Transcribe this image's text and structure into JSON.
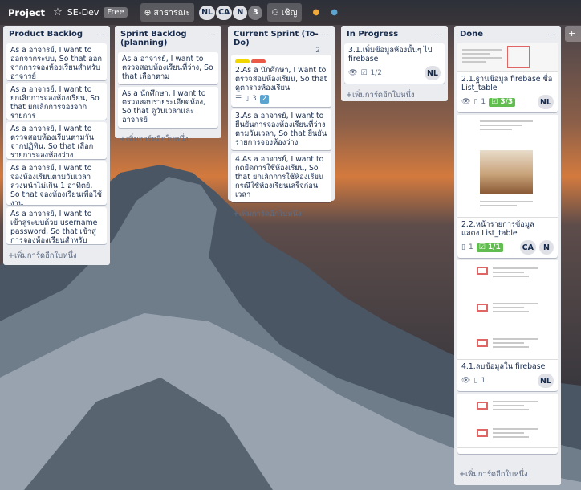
{
  "header": {
    "project": "Project",
    "board_name": "SE-Dev",
    "plan": "Free",
    "visibility": "สาธารณะ",
    "members": [
      "NL",
      "CA",
      "N"
    ],
    "member_count": "3",
    "invite": "เชิญ"
  },
  "lists": [
    {
      "title": "Product Backlog",
      "menu": "...",
      "cards": [
        {
          "text": "As a อาจารย์, I want to ออกจากระบบ, So that ออกจากการจองห้องเรียนสำหรับอาจารย์"
        },
        {
          "text": "As a อาจารย์, I want to ยกเลิกการจองห้องเรียน, So that ยกเลิกการจองจากรายการ"
        },
        {
          "text": "As a อาจารย์, I want to ตรวจสอบห้องเรียนตามวันจากปฏิทิน, So that เลือกรายการจองห้องว่าง"
        },
        {
          "text": "As a อาจารย์, I want to จองห้องเรียนตามวันเวลาล่วงหน้าไม่เกิน 1 อาทิตย์, So that จองห้องเรียนเพื่อใช้งาน"
        },
        {
          "text": "As a อาจารย์, I want to เข้าสู่ระบบด้วย username password, So that เข้าสู่การจองห้องเรียนสำหรับอาจารย์"
        }
      ],
      "add": "+เพิ่มการ์ดอีกใบหนึ่ง"
    },
    {
      "title": "Sprint Backlog (planning)",
      "menu": "...",
      "cards": [
        {
          "text": "As a อาจารย์, I want to ตรวจสอบห้องเรียนที่ว่าง, So that เลือกตาม"
        },
        {
          "text": "As a นักศึกษา, I want to ตรวจสอบรายระเอียดห้อง, So that ดูวันเวลาและอาจารย์"
        }
      ],
      "add": "+เพิ่มการ์ดอีกใบหนึ่ง"
    },
    {
      "title": "Current Sprint (To-Do)",
      "count": "2",
      "menu": "...",
      "cards": [
        {
          "text": "2.As a นักศึกษา, I want to ตรวจสอบห้องเรียน, So that ดูตารางห้องเรียน",
          "attachments": "3",
          "badge": "2"
        },
        {
          "text": "3.As a อาจารย์, I want to ยืนยันการจองห้องเรียนที่ว่างตามวันเวลา, So that ยืนยันรายการจองห้องว่าง"
        },
        {
          "text": "4.As a อาจารย์, I want to กดยืดการใช้ห้องเรียน, So that ยกเลิกการใช้ห้องเรียนกรณีใช้ห้องเรียนเสร็จก่อนเวลา"
        }
      ],
      "add": "+เพิ่มการ์ดอีกใบหนึ่ง"
    },
    {
      "title": "In Progress",
      "menu": "...",
      "cards": [
        {
          "text": "3.1.เพิ่มข้อมูลห้องนั้นๆ ไป firebase",
          "checklist": "1/2",
          "members": [
            "NL"
          ]
        }
      ],
      "add": "+เพิ่มการ์ดอีกใบหนึ่ง"
    },
    {
      "title": "Done",
      "menu": "...",
      "cards": [
        {
          "text": "2.1.ฐานข้อมูล firebase ชื่อ List_table",
          "attachments": "1",
          "checklist": "3/3",
          "members": [
            "NL"
          ]
        },
        {
          "text": "2.2.หน้ารายการข้อมูล แสดง List_table",
          "attachments": "1",
          "checklist": "1/1",
          "members": [
            "CA",
            "N"
          ]
        },
        {
          "text": "4.1.ลบข้อมูลใน firebase",
          "attachments": "1",
          "members": [
            "NL"
          ]
        },
        {
          "text": ""
        }
      ],
      "add": "+เพิ่มการ์ดอีกใบหนึ่ง"
    }
  ],
  "colors": {
    "label_yellow": "#f2d600",
    "label_red": "#eb5a46",
    "check_green": "#61bd4f",
    "list_bg": "#ebecf0"
  }
}
